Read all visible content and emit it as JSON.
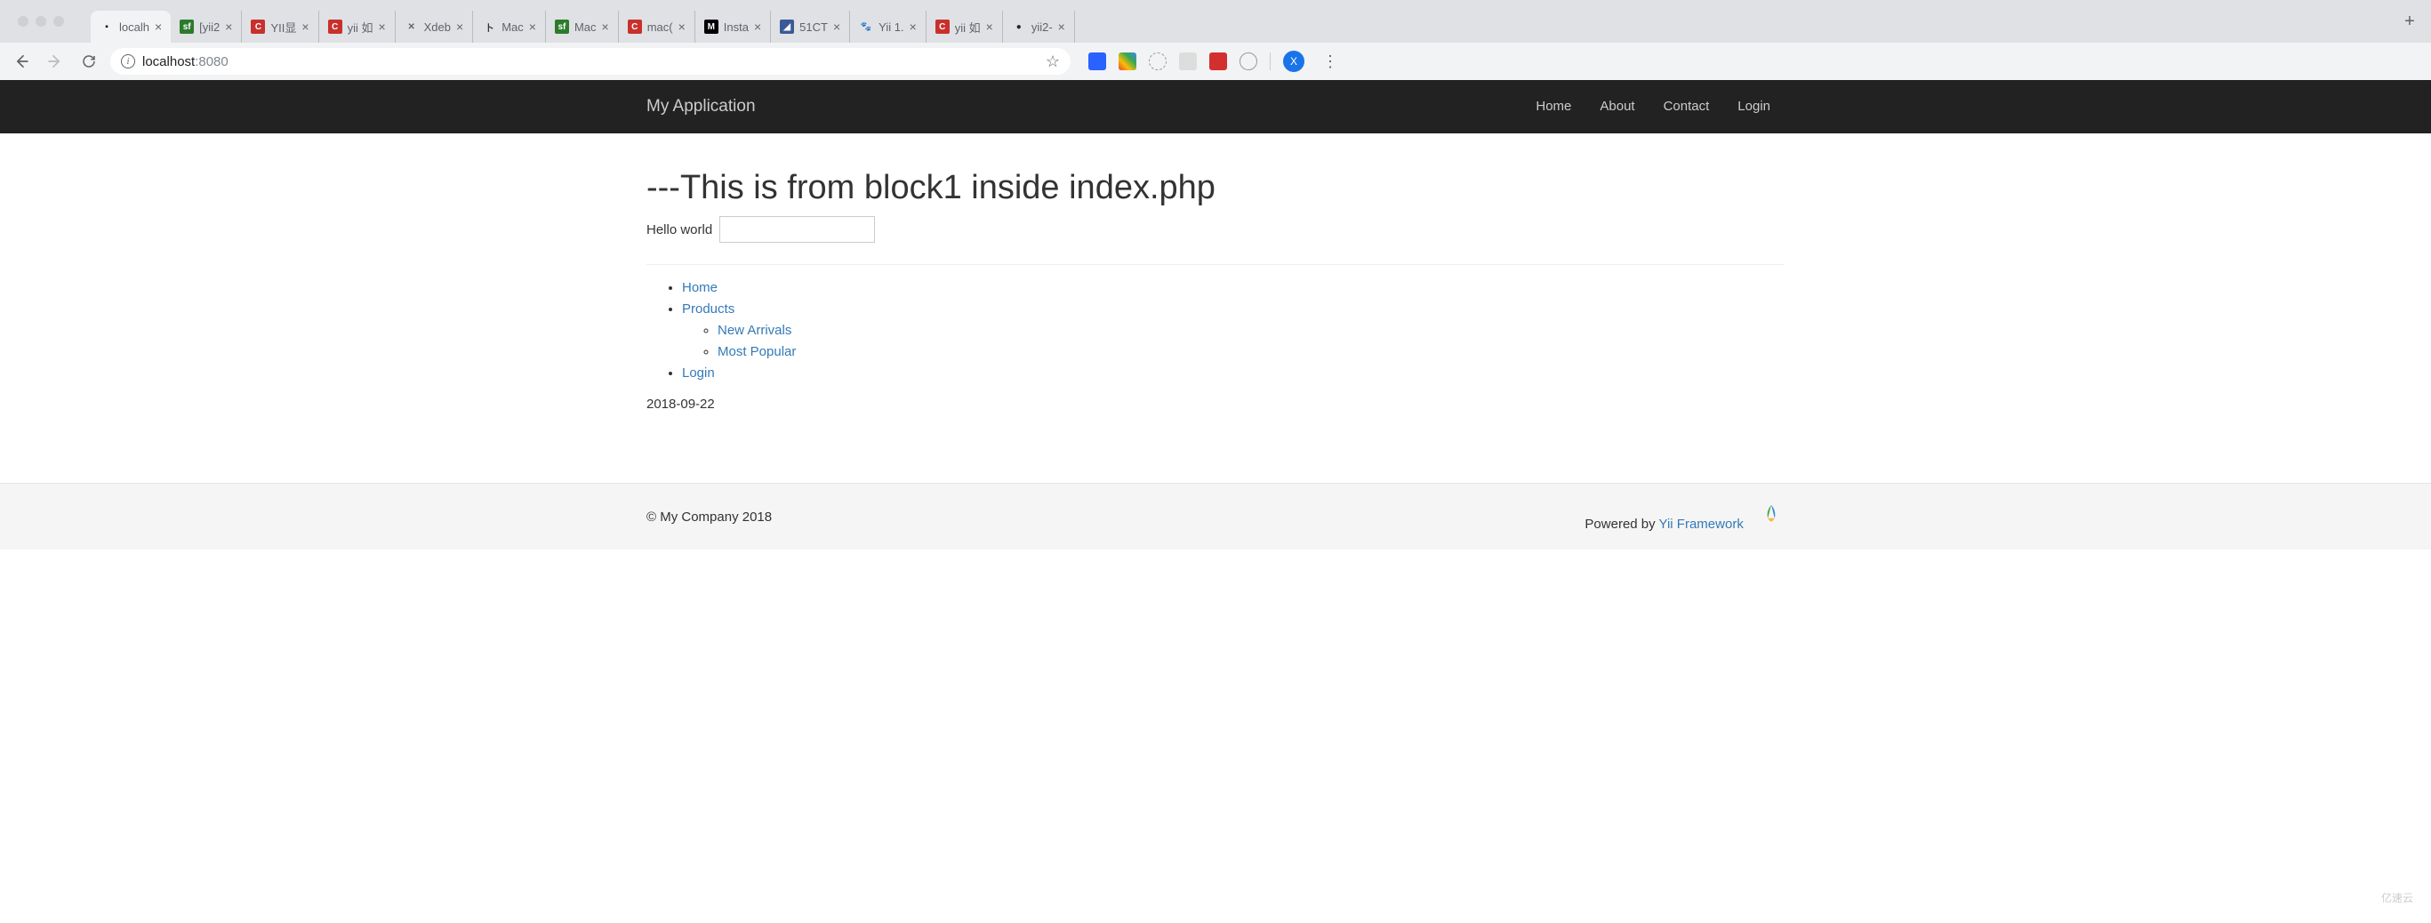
{
  "browser": {
    "tabs": [
      {
        "title": "localh",
        "favicon_bg": "transparent",
        "favicon_text": "▪",
        "favicon_color": "#000",
        "active": true
      },
      {
        "title": "[yii2",
        "favicon_bg": "#2c7b2c",
        "favicon_text": "sf"
      },
      {
        "title": "YII显",
        "favicon_bg": "#c9302c",
        "favicon_text": "C"
      },
      {
        "title": "yii 如",
        "favicon_bg": "#c9302c",
        "favicon_text": "C"
      },
      {
        "title": "Xdeb",
        "favicon_bg": "transparent",
        "favicon_text": "✕",
        "favicon_color": "#666"
      },
      {
        "title": "Mac",
        "favicon_bg": "transparent",
        "favicon_text": "卜",
        "favicon_color": "#333"
      },
      {
        "title": "Mac",
        "favicon_bg": "#2c7b2c",
        "favicon_text": "sf"
      },
      {
        "title": "mac(",
        "favicon_bg": "#c9302c",
        "favicon_text": "C"
      },
      {
        "title": "Insta",
        "favicon_bg": "#000",
        "favicon_text": "M"
      },
      {
        "title": "51CT",
        "favicon_bg": "#3b5998",
        "favicon_text": "◢"
      },
      {
        "title": "Yii 1.",
        "favicon_bg": "transparent",
        "favicon_text": "🐾",
        "favicon_color": "#4285f4"
      },
      {
        "title": "yii 如",
        "favicon_bg": "#c9302c",
        "favicon_text": "C"
      },
      {
        "title": "yii2-",
        "favicon_bg": "transparent",
        "favicon_text": "●",
        "favicon_color": "#24292e"
      }
    ],
    "address": {
      "host": "localhost",
      "port": ":8080"
    },
    "profile_initial": "X"
  },
  "page": {
    "navbar": {
      "brand": "My Application",
      "items": [
        "Home",
        "About",
        "Contact",
        "Login"
      ]
    },
    "heading": "---This is from block1 inside index.php",
    "hello_label": "Hello world",
    "hello_value": "",
    "menu": [
      {
        "label": "Home"
      },
      {
        "label": "Products",
        "children": [
          {
            "label": "New Arrivals"
          },
          {
            "label": "Most Popular"
          }
        ]
      },
      {
        "label": "Login"
      }
    ],
    "date": "2018-09-22",
    "footer": {
      "left": "© My Company 2018",
      "right_prefix": "Powered by ",
      "right_link": "Yii Framework"
    }
  },
  "watermark": "亿速云"
}
